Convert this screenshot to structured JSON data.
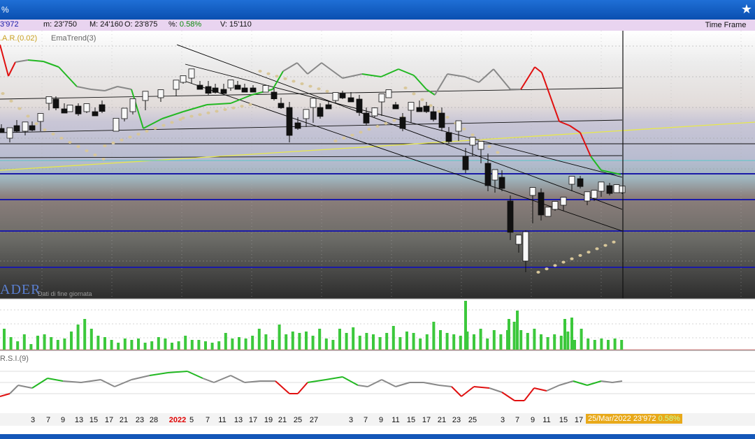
{
  "window": {
    "title": "%"
  },
  "quote": {
    "last": "3'972",
    "min": "m: 23'750",
    "max": "M: 24'160",
    "open": "O: 23'875",
    "change_prefix": "%: ",
    "change": "0.58%",
    "volume": "V: 15'110"
  },
  "toolbar": {
    "time_frame": "Time Frame"
  },
  "indicators": {
    "sar": ".A.R.(0.02)",
    "ematrend": "EmaTrend(3)",
    "rsi": "R.S.I.(9)"
  },
  "branding": {
    "logo": "ADER",
    "eod": "Dati di fine giornata"
  },
  "date_axis": [
    {
      "label": "3"
    },
    {
      "label": "7"
    },
    {
      "label": "9"
    },
    {
      "label": "13"
    },
    {
      "label": "15"
    },
    {
      "label": "17"
    },
    {
      "label": "21"
    },
    {
      "label": "23"
    },
    {
      "label": "28"
    },
    {
      "label": "2022",
      "year": true
    },
    {
      "label": "5"
    },
    {
      "label": "7"
    },
    {
      "label": "11"
    },
    {
      "label": "13"
    },
    {
      "label": "17"
    },
    {
      "label": "19"
    },
    {
      "label": "21"
    },
    {
      "label": "25"
    },
    {
      "label": "27"
    },
    {
      "label": "3"
    },
    {
      "label": "7"
    },
    {
      "label": "9"
    },
    {
      "label": "11"
    },
    {
      "label": "15"
    },
    {
      "label": "17"
    },
    {
      "label": "21"
    },
    {
      "label": "23"
    },
    {
      "label": "25"
    },
    {
      "label": "3"
    },
    {
      "label": "7"
    },
    {
      "label": "9"
    },
    {
      "label": "11"
    },
    {
      "label": "15"
    },
    {
      "label": "17"
    }
  ],
  "cursor": {
    "date_value": "25/Mar/2022 23'972",
    "change": "0.58%"
  },
  "colors": {
    "up": "#f8f8f8",
    "down": "#111111",
    "sar": "#d8c79a",
    "ema_up": "#22b822",
    "ema_down": "#e01010",
    "ema_neutral": "#888888",
    "channel": "#000000",
    "trend_yellow": "#e8e84a",
    "blue_level": "#1a1aa8",
    "volume": "#3cc83c",
    "rsi_up": "#22b822",
    "rsi_down": "#e01010",
    "rsi_neutral": "#888888"
  }
}
